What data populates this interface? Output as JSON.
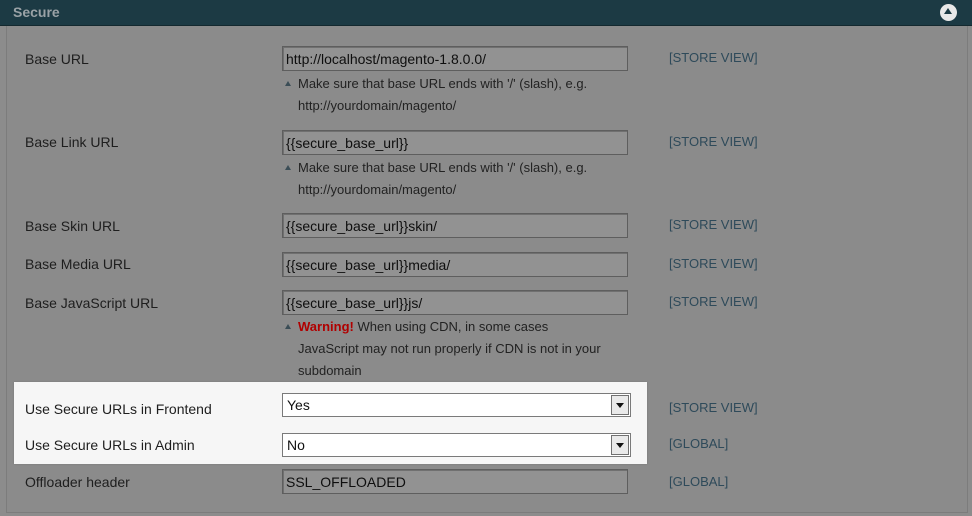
{
  "section": {
    "title": "Secure",
    "collapse_icon": "collapse-up-icon"
  },
  "rows": [
    {
      "label": "Base URL",
      "value": "http://localhost/magento-1.8.0.0/",
      "scope": "[STORE VIEW]",
      "note": [
        "Make sure that base URL ends with '/' (slash), e.g.",
        "http://yourdomain/magento/"
      ]
    },
    {
      "label": "Base Link URL",
      "value": "{{secure_base_url}}",
      "scope": "[STORE VIEW]",
      "note": [
        "Make sure that base URL ends with '/' (slash), e.g.",
        "http://yourdomain/magento/"
      ]
    },
    {
      "label": "Base Skin URL",
      "value": "{{secure_base_url}}skin/",
      "scope": "[STORE VIEW]"
    },
    {
      "label": "Base Media URL",
      "value": "{{secure_base_url}}media/",
      "scope": "[STORE VIEW]"
    },
    {
      "label": "Base JavaScript URL",
      "value": "{{secure_base_url}}js/",
      "scope": "[STORE VIEW]",
      "warning": {
        "strong": "Warning!",
        "line1": "When using CDN, in some cases",
        "line2": "JavaScript may not run properly if CDN is not in your",
        "line3": "subdomain"
      }
    },
    {
      "label": "Use Secure URLs in Frontend",
      "value": "Yes",
      "scope": "[STORE VIEW]"
    },
    {
      "label": "Use Secure URLs in Admin",
      "value": "No",
      "scope": "[GLOBAL]"
    },
    {
      "label": "Offloader header",
      "value": "SSL_OFFLOADED",
      "scope": "[GLOBAL]"
    }
  ],
  "colors": {
    "header_bg": "#1c3a44",
    "warning": "#b00000",
    "scope_text": "#2e4a5a",
    "highlight_bg": "#f6f6f6"
  }
}
